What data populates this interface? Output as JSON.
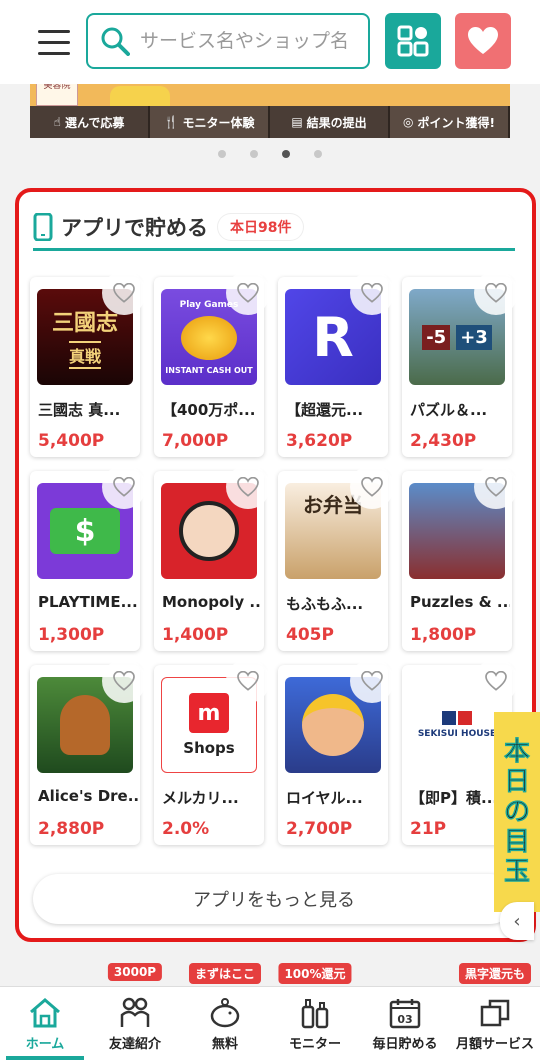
{
  "header": {
    "search_placeholder": "サービス名やショップ名"
  },
  "banner": {
    "steps": [
      {
        "label": "選んで応募"
      },
      {
        "label": "モニター体験"
      },
      {
        "label": "結果の提出"
      },
      {
        "label": "ポイント獲得!"
      }
    ],
    "small_sign": "美容院",
    "dots_active": 3
  },
  "section": {
    "title": "アプリで貯める",
    "badge": "本日98件",
    "more_label": "アプリをもっと見る",
    "apps": [
      {
        "name": "三國志 真...",
        "points": "5,400P",
        "thumb_text": "三國志\n真戦"
      },
      {
        "name": "【400万ポ...",
        "points": "7,000P",
        "thumb_text": "Play Games\nINSTANT CASH OUT"
      },
      {
        "name": "【超還元...",
        "points": "3,620P",
        "thumb_text": "R"
      },
      {
        "name": "パズル＆...",
        "points": "2,430P",
        "thumb_text": "-5 +3"
      },
      {
        "name": "PLAYTIME...",
        "points": "1,300P",
        "thumb_text": "$"
      },
      {
        "name": "Monopoly ...",
        "points": "1,400P",
        "thumb_text": ""
      },
      {
        "name": "もふもふ...",
        "points": "405P",
        "thumb_text": "お弁当"
      },
      {
        "name": "Puzzles & ...",
        "points": "1,800P",
        "thumb_text": ""
      },
      {
        "name": "Alice's Dre...",
        "points": "2,880P",
        "thumb_text": ""
      },
      {
        "name": "メルカリ...",
        "points": "2.0%",
        "thumb_text": "Shops"
      },
      {
        "name": "ロイヤル...",
        "points": "2,700P",
        "thumb_text": ""
      },
      {
        "name": "【即P】積...",
        "points": "21P",
        "thumb_text": "SEKISUI HOUSE"
      }
    ]
  },
  "side_banner": {
    "text": [
      "本",
      "日",
      "の",
      "目",
      "玉"
    ]
  },
  "bottom_nav": [
    {
      "label": "ホーム",
      "badge": "",
      "active": true
    },
    {
      "label": "友達紹介",
      "badge": "3000P"
    },
    {
      "label": "無料",
      "badge": "まずはここ"
    },
    {
      "label": "モニター",
      "badge": "100%還元"
    },
    {
      "label": "毎日貯める",
      "badge": "",
      "day": "03"
    },
    {
      "label": "月額サービス",
      "badge": "黒字還元も"
    }
  ],
  "colors": {
    "accent": "#1aa89b",
    "favorite": "#f07073",
    "points": "#e53e3e",
    "section_border": "#e41a1a"
  }
}
